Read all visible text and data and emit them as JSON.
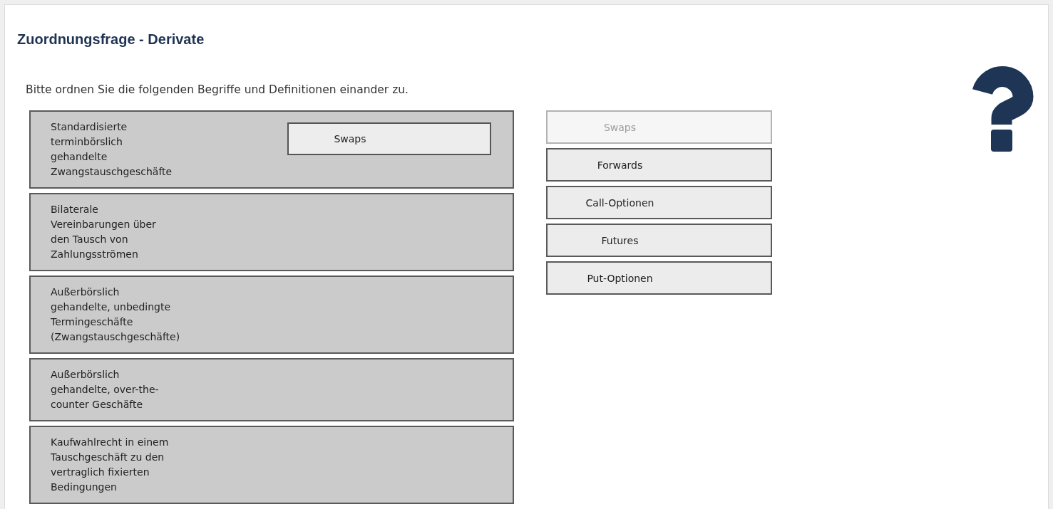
{
  "title": "Zuordnungsfrage - Derivate",
  "instruction": "Bitte ordnen Sie die folgenden Begriffe und Definitionen einander zu.",
  "definitions": [
    {
      "text": "Standardisierte\nterminbörslich\ngehandelte\nZwangstauschgeschäfte",
      "answer": "Swaps"
    },
    {
      "text": "Bilaterale\nVereinbarungen über\nden Tausch von\nZahlungsströmen"
    },
    {
      "text": "Außerbörslich\ngehandelte, unbedingte\nTermingeschäfte\n(Zwangstauschgeschäfte)"
    },
    {
      "text": "Außerbörslich\ngehandelte, over-the-\ncounter Geschäfte"
    },
    {
      "text": "Kaufwahlrecht in einem\nTauschgeschäft zu den\nvertraglich fixierten\nBedingungen"
    }
  ],
  "terms": [
    {
      "label": "Swaps",
      "disabled": true
    },
    {
      "label": "Forwards",
      "disabled": false
    },
    {
      "label": "Call-Optionen",
      "disabled": false
    },
    {
      "label": "Futures",
      "disabled": false
    },
    {
      "label": "Put-Optionen",
      "disabled": false
    }
  ]
}
